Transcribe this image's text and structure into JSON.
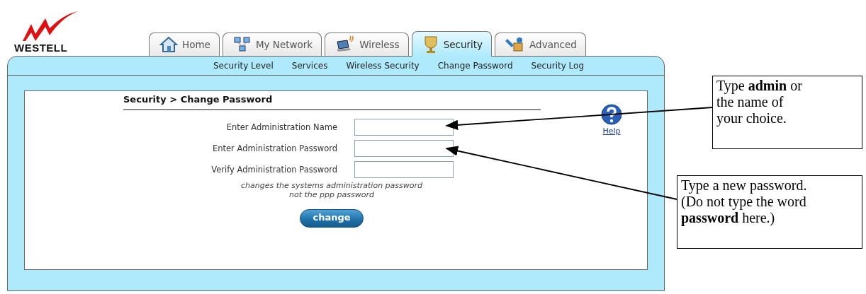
{
  "logo": {
    "text": "WESTELL"
  },
  "tabs": [
    {
      "label": "Home",
      "kind": "home",
      "selected": false
    },
    {
      "label": "My Network",
      "kind": "network",
      "selected": false
    },
    {
      "label": "Wireless",
      "kind": "wireless",
      "selected": false
    },
    {
      "label": "Security",
      "kind": "security",
      "selected": true
    },
    {
      "label": "Advanced",
      "kind": "advanced",
      "selected": false
    }
  ],
  "subnav": [
    "Security Level",
    "Services",
    "Wireless Security",
    "Change Password",
    "Security Log"
  ],
  "breadcrumb": "Security > Change Password",
  "fields": [
    {
      "label": "Enter Administration Name"
    },
    {
      "label": "Enter Administration Password"
    },
    {
      "label": "Verify Administration Password"
    }
  ],
  "note": [
    "changes the systems administration password",
    "not the ppp password"
  ],
  "button": "change",
  "help": "Help",
  "callouts": [
    {
      "lines": [
        "Type **admin** or",
        "the name of",
        "your choice."
      ]
    },
    {
      "lines": [
        "Type a new password.",
        "(Do not type the word",
        "**password** here.)"
      ]
    }
  ]
}
